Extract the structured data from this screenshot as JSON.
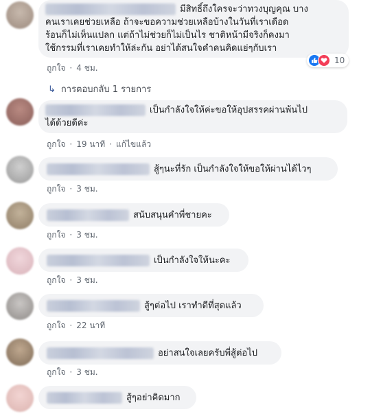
{
  "comments": [
    {
      "text_line1": "มีสิทธิ์ถึงใครจะว่าทวงบุญคุณ บาง",
      "text_line2": "คนเราเคยช่วยเหลือ ถ้าจะขอความช่วยเหลือบ้างในวันที่เราเดือด",
      "text_line3": "ร้อนก็ไม่เห็นแปลก แต่ถ้าไม่ช่วยก็ไม่เป็นไร ชาติหน้ามีจริงก็คงมา",
      "text_line4": "ใช้กรรมที่เราเคยทำให้ล่ะกัน อย่าได้สนใจคำคนคิดแย่ๆกับเรา",
      "like": "ถูกใจ",
      "time": "4 ชม.",
      "reaction_count": "10",
      "replies": "การตอบกลับ 1 รายการ"
    },
    {
      "text_line1": "เป็นกำลังใจให้ค่ะขอให้อุปสรรคผ่านพ้นไป",
      "text_line2": "ได้ด้วยดีค่ะ",
      "like": "ถูกใจ",
      "time": "19 นาที",
      "edited": "แก้ไขแล้ว"
    },
    {
      "text": "สู้ๆนะที่รัก เป็นกำลังใจให้ขอให้ผ่านได้ไวๆ",
      "like": "ถูกใจ",
      "time": "3 ชม."
    },
    {
      "text": "สนับสนุนคำพี่ชายคะ",
      "like": "ถูกใจ",
      "time": "3 ชม."
    },
    {
      "text": "เป็นกำลังใจให้นะคะ",
      "like": "ถูกใจ",
      "time": "3 ชม."
    },
    {
      "text": "สู้ๆต่อไป เราทำดีที่สุดแล้ว",
      "like": "ถูกใจ",
      "time": "22 นาที"
    },
    {
      "text": "อย่าสนใจเลยครับพี่สู้ต่อไป",
      "like": "ถูกใจ",
      "time": "3 ชม."
    },
    {
      "text": "สู้ๆอย่าคิดมาก"
    }
  ],
  "colors": {
    "like_blue": "#1877f2",
    "love_red": "#f33e58",
    "link_blue": "#385898",
    "bubble_bg": "#f2f3f5"
  },
  "icons": {
    "like": "thumbs-up-icon",
    "love": "heart-icon",
    "reply_arrow": "reply-arrow-icon"
  }
}
